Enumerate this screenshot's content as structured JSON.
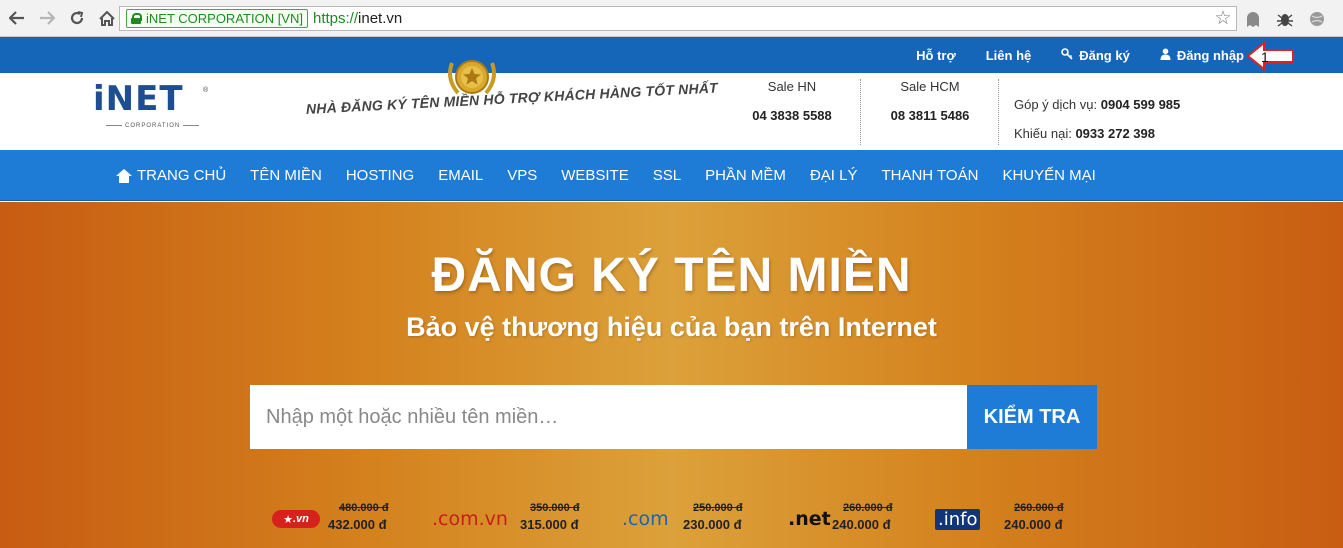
{
  "browser": {
    "ev_label": "iNET CORPORATION [VN]",
    "url_scheme": "https://",
    "url_host": "inet.vn"
  },
  "topbar": {
    "support": "Hỗ trợ",
    "contact": "Liên hệ",
    "register": "Đăng ký",
    "login": "Đăng nhập",
    "annotation": "1"
  },
  "header": {
    "logo": "iNET",
    "logo_sub": "CORPORATION",
    "slogan": "NHÀ ĐĂNG KÝ TÊN MIỀN HỖ TRỢ KHÁCH HÀNG TỐT NHẤT",
    "sale_hn_label": "Sale HN",
    "sale_hn_number": "04 3838 5588",
    "sale_hcm_label": "Sale HCM",
    "sale_hcm_number": "08 3811 5486",
    "feedback_label": "Góp ý dịch vụ:",
    "feedback_number": "0904 599 985",
    "complaint_label": "Khiếu nại:",
    "complaint_number": "0933 272 398"
  },
  "nav": {
    "items": [
      "TRANG CHỦ",
      "TÊN MIỀN",
      "HOSTING",
      "EMAIL",
      "VPS",
      "WEBSITE",
      "SSL",
      "PHẦN MỀM",
      "ĐẠI LÝ",
      "THANH TOÁN",
      "KHUYẾN MẠI"
    ]
  },
  "hero": {
    "title": "ĐĂNG KÝ TÊN MIỀN",
    "subtitle": "Bảo vệ thương hiệu của bạn trên Internet",
    "search_placeholder": "Nhập một hoặc nhiều tên miền…",
    "search_button": "KIỂM TRA"
  },
  "prices": [
    {
      "tld": ".vn",
      "old": "480.000 đ",
      "new": "432.000 đ"
    },
    {
      "tld": ".com.vn",
      "old": "350.000 đ",
      "new": "315.000 đ"
    },
    {
      "tld": ".com",
      "old": "250.000 đ",
      "new": "230.000 đ"
    },
    {
      "tld": ".net",
      "old": "260.000 đ",
      "new": "240.000 đ"
    },
    {
      "tld": ".info",
      "old": "260.000 đ",
      "new": "240.000 đ"
    }
  ],
  "colors": {
    "topbar": "#1565b8",
    "nav": "#1e7bd6",
    "hero_center": "#dca13a",
    "hero_edge": "#c75c12"
  }
}
